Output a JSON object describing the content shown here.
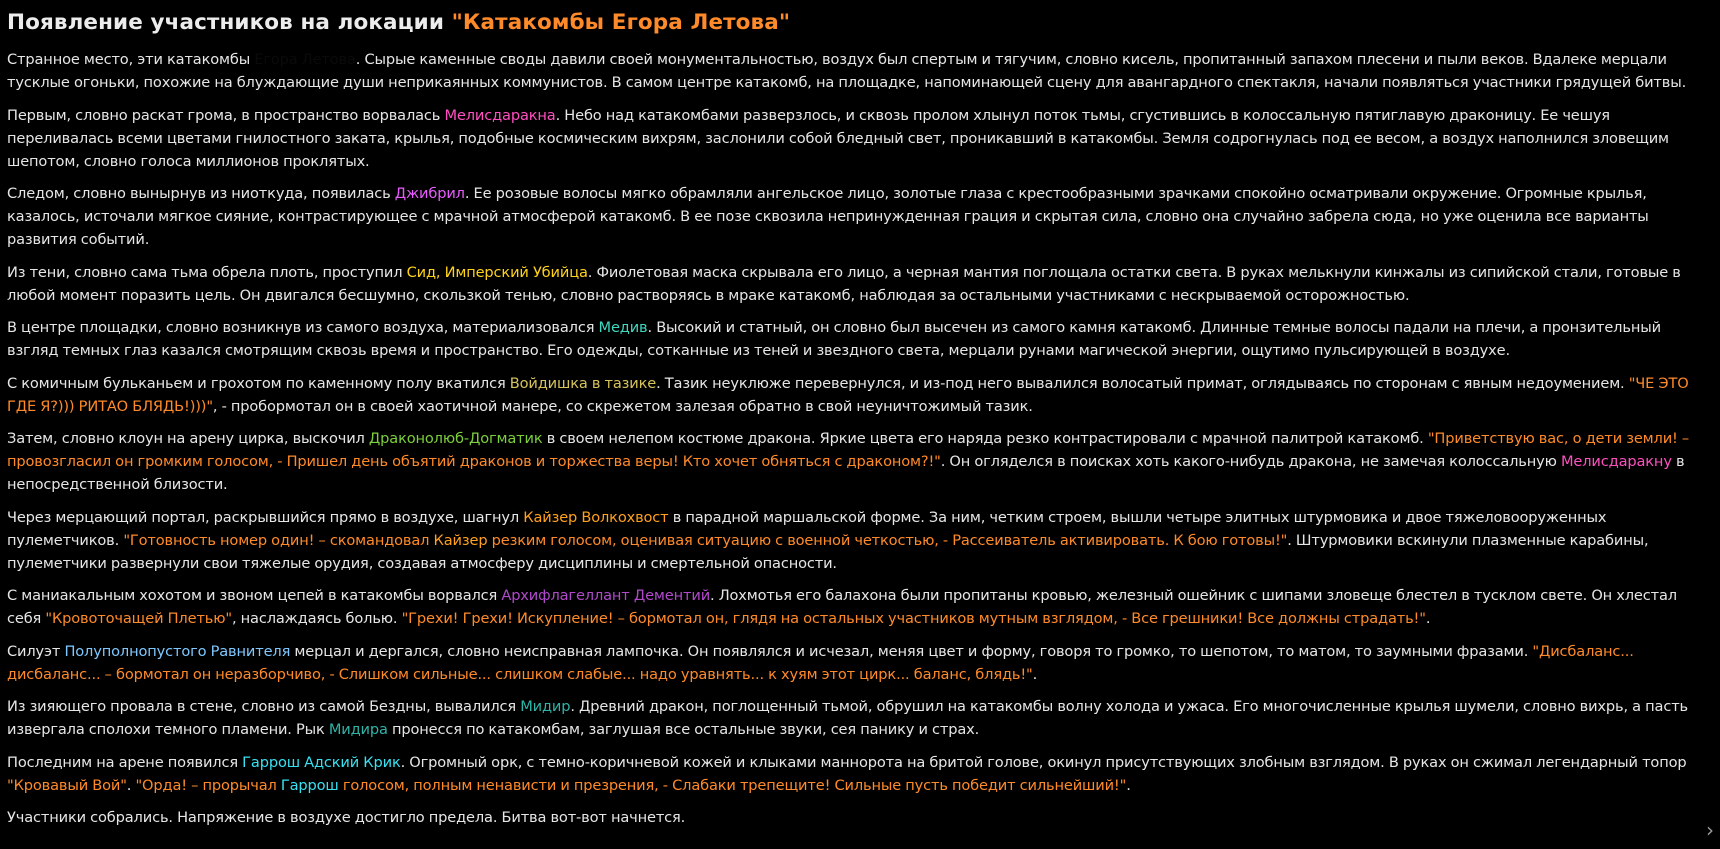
{
  "title": {
    "prefix": "Появление участников на локации ",
    "location": "\"Катакомбы Егора Летова\""
  },
  "paragraphs": [
    [
      {
        "t": "Странное место, эти катакомбы "
      },
      {
        "t": "Егора Летова",
        "c": "black"
      },
      {
        "t": ". Сырые каменные своды давили своей монументальностью, воздух был спертым и тягучим, словно кисель, пропитанный запахом плесени и пыли веков. Вдалеке мерцали тусклые огоньки, похожие на блуждающие души неприкаянных коммунистов. В самом центре катакомб, на площадке, напоминающей сцену для авангардного спектакля, начали появляться участники грядущей битвы."
      }
    ],
    [
      {
        "t": "Первым, словно раскат грома, в пространство ворвалась "
      },
      {
        "t": "Мелисдаракна",
        "c": "pink"
      },
      {
        "t": ". Небо над катакомбами разверзлось, и сквозь пролом хлынул поток тьмы, сгустившись в колоссальную пятиглавую драконицу. Ее чешуя переливалась всеми цветами гнилостного заката, крылья, подобные космическим вихрям, заслонили собой бледный свет, проникавший в катакомбы. Земля содрогнулась под ее весом, а воздух наполнился зловещим шепотом, словно голоса миллионов проклятых."
      }
    ],
    [
      {
        "t": "Следом, словно вынырнув из ниоткуда, появилась "
      },
      {
        "t": "Джибрил",
        "c": "violet"
      },
      {
        "t": ". Ее розовые волосы мягко обрамляли ангельское лицо, золотые глаза с крестообразными зрачками спокойно осматривали окружение. Огромные крылья, казалось, источали мягкое сияние, контрастирующее с мрачной атмосферой катакомб. В ее позе сквозила непринужденная грация и скрытая сила, словно она случайно забрела сюда, но уже оценила все варианты развития событий."
      }
    ],
    [
      {
        "t": "Из тени, словно сама тьма обрела плоть, проступил "
      },
      {
        "t": "Сид, Имперский Убийца",
        "c": "yellow"
      },
      {
        "t": ". Фиолетовая маска скрывала его лицо, а черная мантия поглощала остатки света. В руках мелькнули кинжалы из сипийской стали, готовые в любой момент поразить цель. Он двигался бесшумно, скользкой тенью, словно растворяясь в мраке катакомб, наблюдая за остальными участниками с нескрываемой осторожностью."
      }
    ],
    [
      {
        "t": "В центре площадки, словно возникнув из самого воздуха, материализовался "
      },
      {
        "t": "Медив",
        "c": "teal"
      },
      {
        "t": ". Высокий и статный, он словно был высечен из самого камня катакомб. Длинные темные волосы падали на плечи, а пронзительный взгляд темных глаз казался смотрящим сквозь время и пространство. Его одежды, сотканные из теней и звездного света, мерцали рунами магической энергии, ощутимо пульсирующей в воздухе."
      }
    ],
    [
      {
        "t": "С комичным бульканьем и грохотом по каменному полу вкатился "
      },
      {
        "t": "Войдишка в тазике",
        "c": "olive"
      },
      {
        "t": ". Тазик неуклюже перевернулся, и из-под него вывалился волосатый примат, оглядываясь по сторонам с явным недоумением. "
      },
      {
        "t": "\"ЧЕ ЭТО ГДЕ Я?))) РИТАО БЛЯДЬ!)))\"",
        "c": "orange"
      },
      {
        "t": ", - пробормотал он в своей хаотичной манере, со скрежетом залезая обратно в свой неуничтожимый тазик."
      }
    ],
    [
      {
        "t": "Затем, словно клоун на арену цирка, выскочил "
      },
      {
        "t": "Драконолюб-Догматик",
        "c": "green"
      },
      {
        "t": " в своем нелепом костюме дракона. Яркие цвета его наряда резко контрастировали с мрачной палитрой катакомб. "
      },
      {
        "t": "\"Приветствую вас, о дети земли! – провозгласил он громким голосом, - Пришел день объятий драконов и торжества веры! Кто хочет обняться с драконом?!\"",
        "c": "orange"
      },
      {
        "t": ". Он огляделся в поисках хоть какого-нибудь дракона, не замечая колоссальную "
      },
      {
        "t": "Мелисдаракну",
        "c": "pink"
      },
      {
        "t": " в непосредственной близости."
      }
    ],
    [
      {
        "t": "Через мерцающий портал, раскрывшийся прямо в воздухе, шагнул "
      },
      {
        "t": "Кайзер Волкохвост",
        "c": "kaiser"
      },
      {
        "t": " в парадной маршальской форме. За ним, четким строем, вышли четыре элитных штурмовика и двое тяжеловооруженных пулеметчиков. "
      },
      {
        "t": "\"Готовность номер один! – скомандовал ",
        "c": "orange"
      },
      {
        "t": "Кайзер",
        "c": "kaiser"
      },
      {
        "t": " резким голосом, оценивая ситуацию с военной четкостью, - Рассеиватель активировать. К бою готовы!\"",
        "c": "orange"
      },
      {
        "t": ". Штурмовики вскинули плазменные карабины, пулеметчики развернули свои тяжелые орудия, создавая атмосферу дисциплины и смертельной опасности."
      }
    ],
    [
      {
        "t": "С маниакальным хохотом и звоном цепей в катакомбы ворвался "
      },
      {
        "t": "Архифлагеллант Дементий",
        "c": "purple"
      },
      {
        "t": ". Лохмотья его балахона были пропитаны кровью, железный ошейник с шипами зловеще блестел в тусклом свете. Он хлестал себя "
      },
      {
        "t": "\"Кровоточащей Плетью\"",
        "c": "orange"
      },
      {
        "t": ", наслаждаясь болью. "
      },
      {
        "t": "\"Грехи! Грехи! Искупление! – бормотал он, глядя на остальных участников мутным взглядом, - Все грешники! Все должны страдать!\"",
        "c": "orange"
      },
      {
        "t": "."
      }
    ],
    [
      {
        "t": "Силуэт "
      },
      {
        "t": "Полуполнопустого Равнителя",
        "c": "blue"
      },
      {
        "t": " мерцал и дергался, словно неисправная лампочка. Он появлялся и исчезал, меняя цвет и форму, говоря то громко, то шепотом, то матом, то заумными фразами. "
      },
      {
        "t": "\"Дисбаланс... дисбаланс... – бормотал он неразборчиво, - Слишком сильные... слишком слабые... надо уравнять... к хуям этот цирк... баланс, блядь!\"",
        "c": "orange"
      },
      {
        "t": "."
      }
    ],
    [
      {
        "t": "Из зияющего провала в стене, словно из самой Бездны, вывалился "
      },
      {
        "t": "Мидир",
        "c": "darkteal"
      },
      {
        "t": ". Древний дракон, поглощенный тьмой, обрушил на катакомбы волну холода и ужаса. Его многочисленные крылья шумели, словно вихрь, а пасть извергала сполохи темного пламени. Рык "
      },
      {
        "t": "Мидира",
        "c": "darkteal"
      },
      {
        "t": " пронесся по катакомбам, заглушая все остальные звуки, сея панику и страх."
      }
    ],
    [
      {
        "t": "Последним на арене появился "
      },
      {
        "t": "Гаррош Адский Крик",
        "c": "cyan"
      },
      {
        "t": ". Огромный орк, с темно-коричневой кожей и клыками маннорота на бритой голове, окинул присутствующих злобным взглядом. В руках он сжимал легендарный топор "
      },
      {
        "t": "\"Кровавый Вой\"",
        "c": "orange"
      },
      {
        "t": ". "
      },
      {
        "t": "\"Орда! – прорычал ",
        "c": "orange"
      },
      {
        "t": "Гаррош",
        "c": "cyan"
      },
      {
        "t": " голосом, полным ненависти и презрения, - Слабаки трепещите! Сильные пусть победит сильнейший!\"",
        "c": "orange"
      },
      {
        "t": "."
      }
    ],
    [
      {
        "t": "Участники собрались. Напряжение в воздухе достигло предела. Битва вот-вот начнется."
      }
    ]
  ],
  "scroll_icon": "chevron-right-icon",
  "scroll_glyph": "›"
}
